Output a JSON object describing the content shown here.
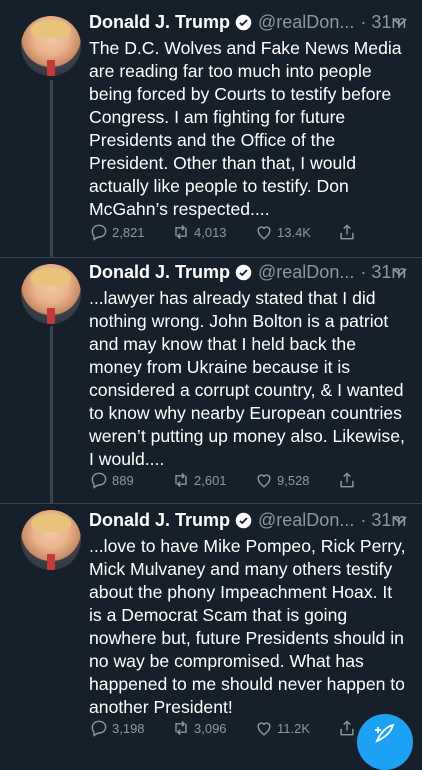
{
  "tweets": [
    {
      "author": "Donald J. Trump",
      "handle": "@realDon...",
      "time": "· 31m",
      "text": "The D.C. Wolves and Fake News Media are reading far too much into people being forced by Courts to testify before Congress. I am fighting for future Presidents and the Office of the President. Other than that, I would actually like people to testify. Don McGahn’s respected....",
      "replies": "2,821",
      "retweets": "4,013",
      "likes": "13.4K"
    },
    {
      "author": "Donald J. Trump",
      "handle": "@realDon...",
      "time": "· 31m",
      "text": "...lawyer has already stated that I did nothing wrong. John Bolton is a patriot and may know that I held back the money from Ukraine because it is considered a corrupt country, & I wanted to know why nearby European countries weren’t putting up money also. Likewise, I would....",
      "replies": "889",
      "retweets": "2,601",
      "likes": "9,528"
    },
    {
      "author": "Donald J. Trump",
      "handle": "@realDon...",
      "time": "· 31m",
      "text": "...love to have Mike Pompeo, Rick Perry, Mick Mulvaney and many others testify about the phony Impeachment Hoax. It is a Democrat Scam that is going nowhere but, future Presidents should in no way be compromised. What has happened to me should never happen to another President!",
      "replies": "3,198",
      "retweets": "3,096",
      "likes": "11.2K"
    }
  ],
  "icons": {
    "verified": "verified-badge-icon",
    "reply": "reply-icon",
    "retweet": "retweet-icon",
    "like": "heart-icon",
    "share": "share-icon",
    "more": "chevron-down-icon",
    "compose": "compose-feather-icon"
  },
  "colors": {
    "background": "#15202b",
    "secondary_text": "#8899a6",
    "accent": "#1da1f2",
    "divider": "#38444d"
  }
}
